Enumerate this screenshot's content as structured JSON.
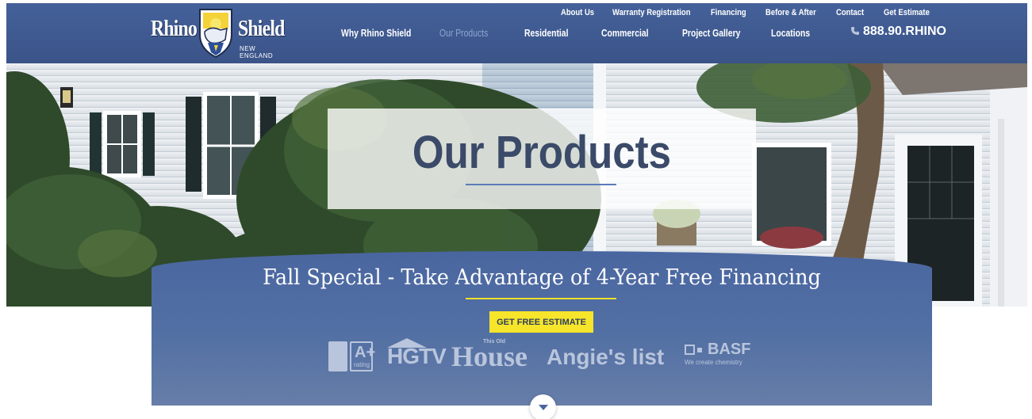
{
  "brand": {
    "left_word": "Rhino",
    "right_word": "Shield",
    "subtitle": "NEW ENGLAND",
    "icon": "rhino-shield-badge"
  },
  "utility_nav": [
    {
      "label": "About Us"
    },
    {
      "label": "Warranty Registration"
    },
    {
      "label": "Financing"
    },
    {
      "label": "Before & After"
    },
    {
      "label": "Contact"
    },
    {
      "label": "Get Estimate"
    }
  ],
  "main_nav": [
    {
      "label": "Why Rhino Shield"
    },
    {
      "label": "Our Products"
    },
    {
      "label": "Residential"
    },
    {
      "label": "Commercial"
    },
    {
      "label": "Project Gallery"
    },
    {
      "label": "Locations"
    }
  ],
  "phone": {
    "number": "888.90.RHINO",
    "icon": "phone-icon"
  },
  "hero": {
    "title": "Our Products"
  },
  "promo": {
    "headline": "Fall Special - Take Advantage of 4-Year Free Financing",
    "cta_label": "GET FREE ESTIMATE"
  },
  "trust_badges": {
    "bbb_grade": "A+",
    "bbb_rating": "rating",
    "hgtv": "HGTV",
    "this_old_house_small": "This Old",
    "this_old_house_big": "House",
    "angies": "Angie's list",
    "basf_name": "BASF",
    "basf_tagline": "We create chemistry"
  },
  "colors": {
    "header_blue": "#3f5a90",
    "promo_blue": "#5370a4",
    "cta_yellow": "#f6e52a",
    "title_navy": "#3a4a68",
    "active_nav": "#8ea6d0"
  }
}
